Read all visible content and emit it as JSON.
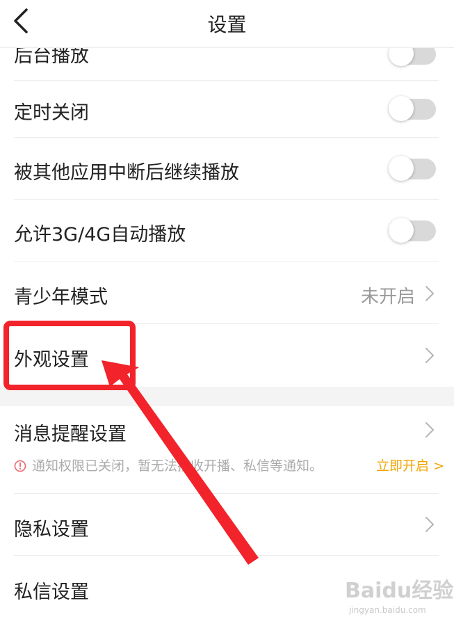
{
  "header": {
    "title": "设置"
  },
  "settings": {
    "bg_play": {
      "label": "后台播放",
      "toggle": "off"
    },
    "timed_close": {
      "label": "定时关闭",
      "toggle": "off"
    },
    "continue_after_interrupt": {
      "label": "被其他应用中断后继续播放",
      "toggle": "off"
    },
    "mobile_autoplay": {
      "label": "允许3G/4G自动播放",
      "toggle": "off"
    },
    "teen_mode": {
      "label": "青少年模式",
      "value": "未开启"
    },
    "appearance": {
      "label": "外观设置"
    },
    "notifications": {
      "label": "消息提醒设置",
      "notice": "通知权限已关闭，暂无法接收开播、私信等通知。",
      "action": "立即开启 >"
    },
    "privacy": {
      "label": "隐私设置"
    },
    "dm": {
      "label": "私信设置"
    }
  },
  "watermark": {
    "logo": "Baidu经验",
    "url": "jingyan.baidu.com"
  },
  "colors": {
    "highlight": "#f2232b",
    "accent": "#f0a500",
    "toggle_off": "#d9d9d9"
  }
}
